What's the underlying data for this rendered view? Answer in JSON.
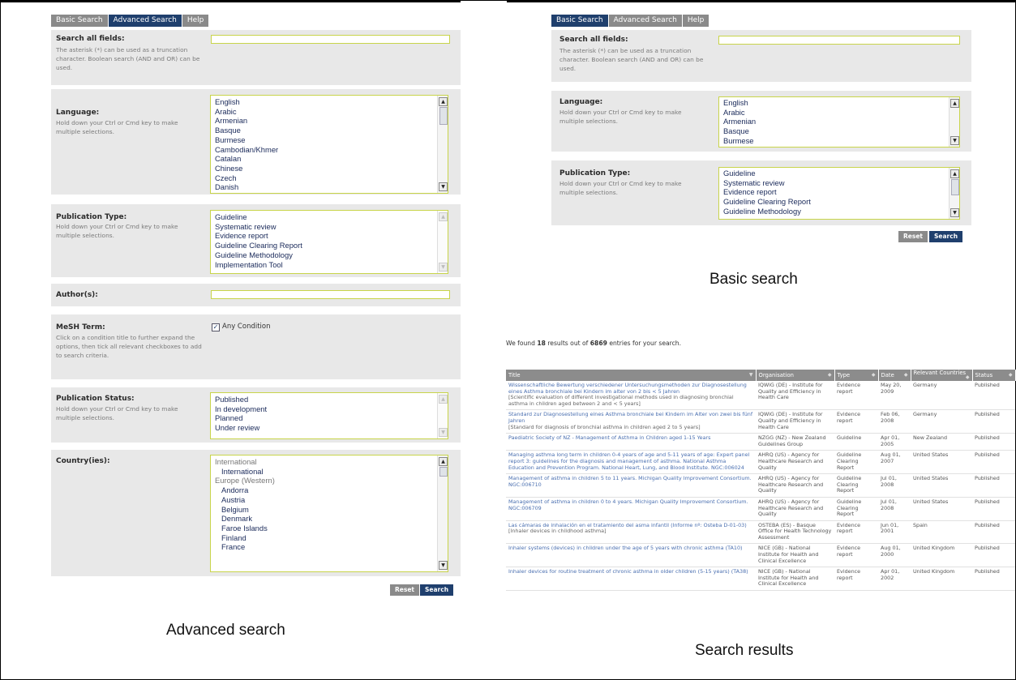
{
  "advanced": {
    "tabs": [
      "Basic Search",
      "Advanced Search",
      "Help"
    ],
    "active_tab": "Advanced Search",
    "search_all": {
      "label": "Search all fields:",
      "hint": "The asterisk (*) can be used as a truncation character. Boolean search (AND and OR) can be used.",
      "value": ""
    },
    "language": {
      "label": "Language:",
      "hint": "Hold down your Ctrl or Cmd key to make multiple selections.",
      "options": [
        "English",
        "Arabic",
        "Armenian",
        "Basque",
        "Burmese",
        "Cambodian/Khmer",
        "Catalan",
        "Chinese",
        "Czech",
        "Danish"
      ]
    },
    "publication_type": {
      "label": "Publication Type:",
      "hint": "Hold down your Ctrl or Cmd key to make multiple selections.",
      "options": [
        "Guideline",
        "Systematic review",
        "Evidence report",
        "Guideline Clearing Report",
        "Guideline Methodology",
        "Implementation Tool"
      ]
    },
    "authors": {
      "label": "Author(s):",
      "value": ""
    },
    "mesh": {
      "label": "MeSH Term:",
      "hint": "Click on a condition title to further expand the options, then tick all relevant checkboxes to add to search criteria.",
      "checkbox_label": "Any Condition",
      "checked": true
    },
    "publication_status": {
      "label": "Publication Status:",
      "hint": "Hold down your Ctrl or Cmd key to make multiple selections.",
      "options": [
        "Published",
        "In development",
        "Planned",
        "Under review"
      ]
    },
    "countries": {
      "label": "Country(ies):",
      "options": [
        {
          "text": "International",
          "group": true
        },
        {
          "text": "International",
          "group": false
        },
        {
          "text": "Europe (Western)",
          "group": true
        },
        {
          "text": "Andorra",
          "group": false
        },
        {
          "text": "Austria",
          "group": false
        },
        {
          "text": "Belgium",
          "group": false
        },
        {
          "text": "Denmark",
          "group": false
        },
        {
          "text": "Faroe Islands",
          "group": false
        },
        {
          "text": "Finland",
          "group": false
        },
        {
          "text": "France",
          "group": false
        }
      ]
    },
    "reset_label": "Reset",
    "search_label": "Search",
    "caption": "Advanced search"
  },
  "basic": {
    "tabs": [
      "Basic Search",
      "Advanced Search",
      "Help"
    ],
    "active_tab": "Basic Search",
    "search_all": {
      "label": "Search all fields:",
      "hint": "The asterisk (*) can be used as a truncation character. Boolean search (AND and OR) can be used.",
      "value": ""
    },
    "language": {
      "label": "Language:",
      "hint": "Hold down your Ctrl or Cmd key to make multiple selections.",
      "options": [
        "English",
        "Arabic",
        "Armenian",
        "Basque",
        "Burmese"
      ]
    },
    "publication_type": {
      "label": "Publication Type:",
      "hint": "Hold down your Ctrl or Cmd key to make multiple selections.",
      "options": [
        "Guideline",
        "Systematic review",
        "Evidence report",
        "Guideline Clearing Report",
        "Guideline Methodology"
      ]
    },
    "reset_label": "Reset",
    "search_label": "Search",
    "caption": "Basic search"
  },
  "results": {
    "summary_pre": "We found ",
    "summary_count": "18",
    "summary_mid": " results out of ",
    "summary_total": "6869",
    "summary_post": " entries for your search.",
    "columns": [
      "Title",
      "Organisation",
      "Type",
      "Date",
      "Relevant Countries",
      "Status"
    ],
    "rows": [
      {
        "title": "Wissenschaftliche Bewertung verschiedener Untersuchungsmethoden zur Diagnosestellung eines Asthma bronchiale bei Kindern im alter von 2 bis < 5 Jahren",
        "translation": "[Scientific evaluation of different investigational methods used in diagnosing bronchial asthma in children aged between 2 and < 5 years]",
        "organisation": "IQWiG (DE) - Institute for Quality and Efficiency in Health Care",
        "type": "Evidence report",
        "date": "May 20, 2009",
        "countries": "Germany",
        "status": "Published"
      },
      {
        "title": "Standard zur Diagnosestellung eines Asthma bronchiale bei Kindern im Alter von zwei bis fünf Jahren",
        "translation": "[Standard for diagnosis of bronchial asthma in children aged 2 to 5 years]",
        "organisation": "IQWiG (DE) - Institute for Quality and Efficiency in Health Care",
        "type": "Evidence report",
        "date": "Feb 06, 2008",
        "countries": "Germany",
        "status": "Published"
      },
      {
        "title": "Paediatric Society of NZ - Management of Asthma in Children aged 1-15 Years",
        "translation": "",
        "organisation": "NZGG (NZ) - New Zealand Guidelines Group",
        "type": "Guideline",
        "date": "Apr 01, 2005",
        "countries": "New Zealand",
        "status": "Published"
      },
      {
        "title": "Managing asthma long term in children 0-4 years of age and 5-11 years of age: Expert panel report 3: guidelines for the diagnosis and management of asthma. National Asthma Education and Prevention Program. National Heart, Lung, and Blood Institute. NGC:006024",
        "translation": "",
        "organisation": "AHRQ (US) - Agency for Healthcare Research and Quality",
        "type": "Guideline Clearing Report",
        "date": "Aug 01, 2007",
        "countries": "United States",
        "status": "Published"
      },
      {
        "title": "Management of asthma in children 5 to 11 years. Michigan Quality Improvement Consortium. NGC:006710",
        "translation": "",
        "organisation": "AHRQ (US) - Agency for Healthcare Research and Quality",
        "type": "Guideline Clearing Report",
        "date": "Jul 01, 2008",
        "countries": "United States",
        "status": "Published"
      },
      {
        "title": "Management of asthma in children 0 to 4 years. Michigan Quality Improvement Consortium. NGC:006709",
        "translation": "",
        "organisation": "AHRQ (US) - Agency for Healthcare Research and Quality",
        "type": "Guideline Clearing Report",
        "date": "Jul 01, 2008",
        "countries": "United States",
        "status": "Published"
      },
      {
        "title": "Las cámaras de inhalación en el tratamiento del asma infantil (Informe nº: Osteba D-01-03)",
        "translation": "[Inhaler devices in childhood asthma]",
        "organisation": "OSTEBA (ES) - Basque Office for Health Technology Assessment",
        "type": "Evidence report",
        "date": "Jun 01, 2001",
        "countries": "Spain",
        "status": "Published"
      },
      {
        "title": "Inhaler systems (devices) in children under the age of 5 years with chronic asthma (TA10)",
        "translation": "",
        "organisation": "NICE (GB) - National Institute for Health and Clinical Excellence",
        "type": "Evidence report",
        "date": "Aug 01, 2000",
        "countries": "United Kingdom",
        "status": "Published"
      },
      {
        "title": "Inhaler devices for routine treatment of chronic asthma in older children (5-15 years) (TA38)",
        "translation": "",
        "organisation": "NICE (GB) - National Institute for Health and Clinical Excellence",
        "type": "Evidence report",
        "date": "Apr 01, 2002",
        "countries": "United Kingdom",
        "status": "Published"
      }
    ],
    "caption": "Search results"
  }
}
